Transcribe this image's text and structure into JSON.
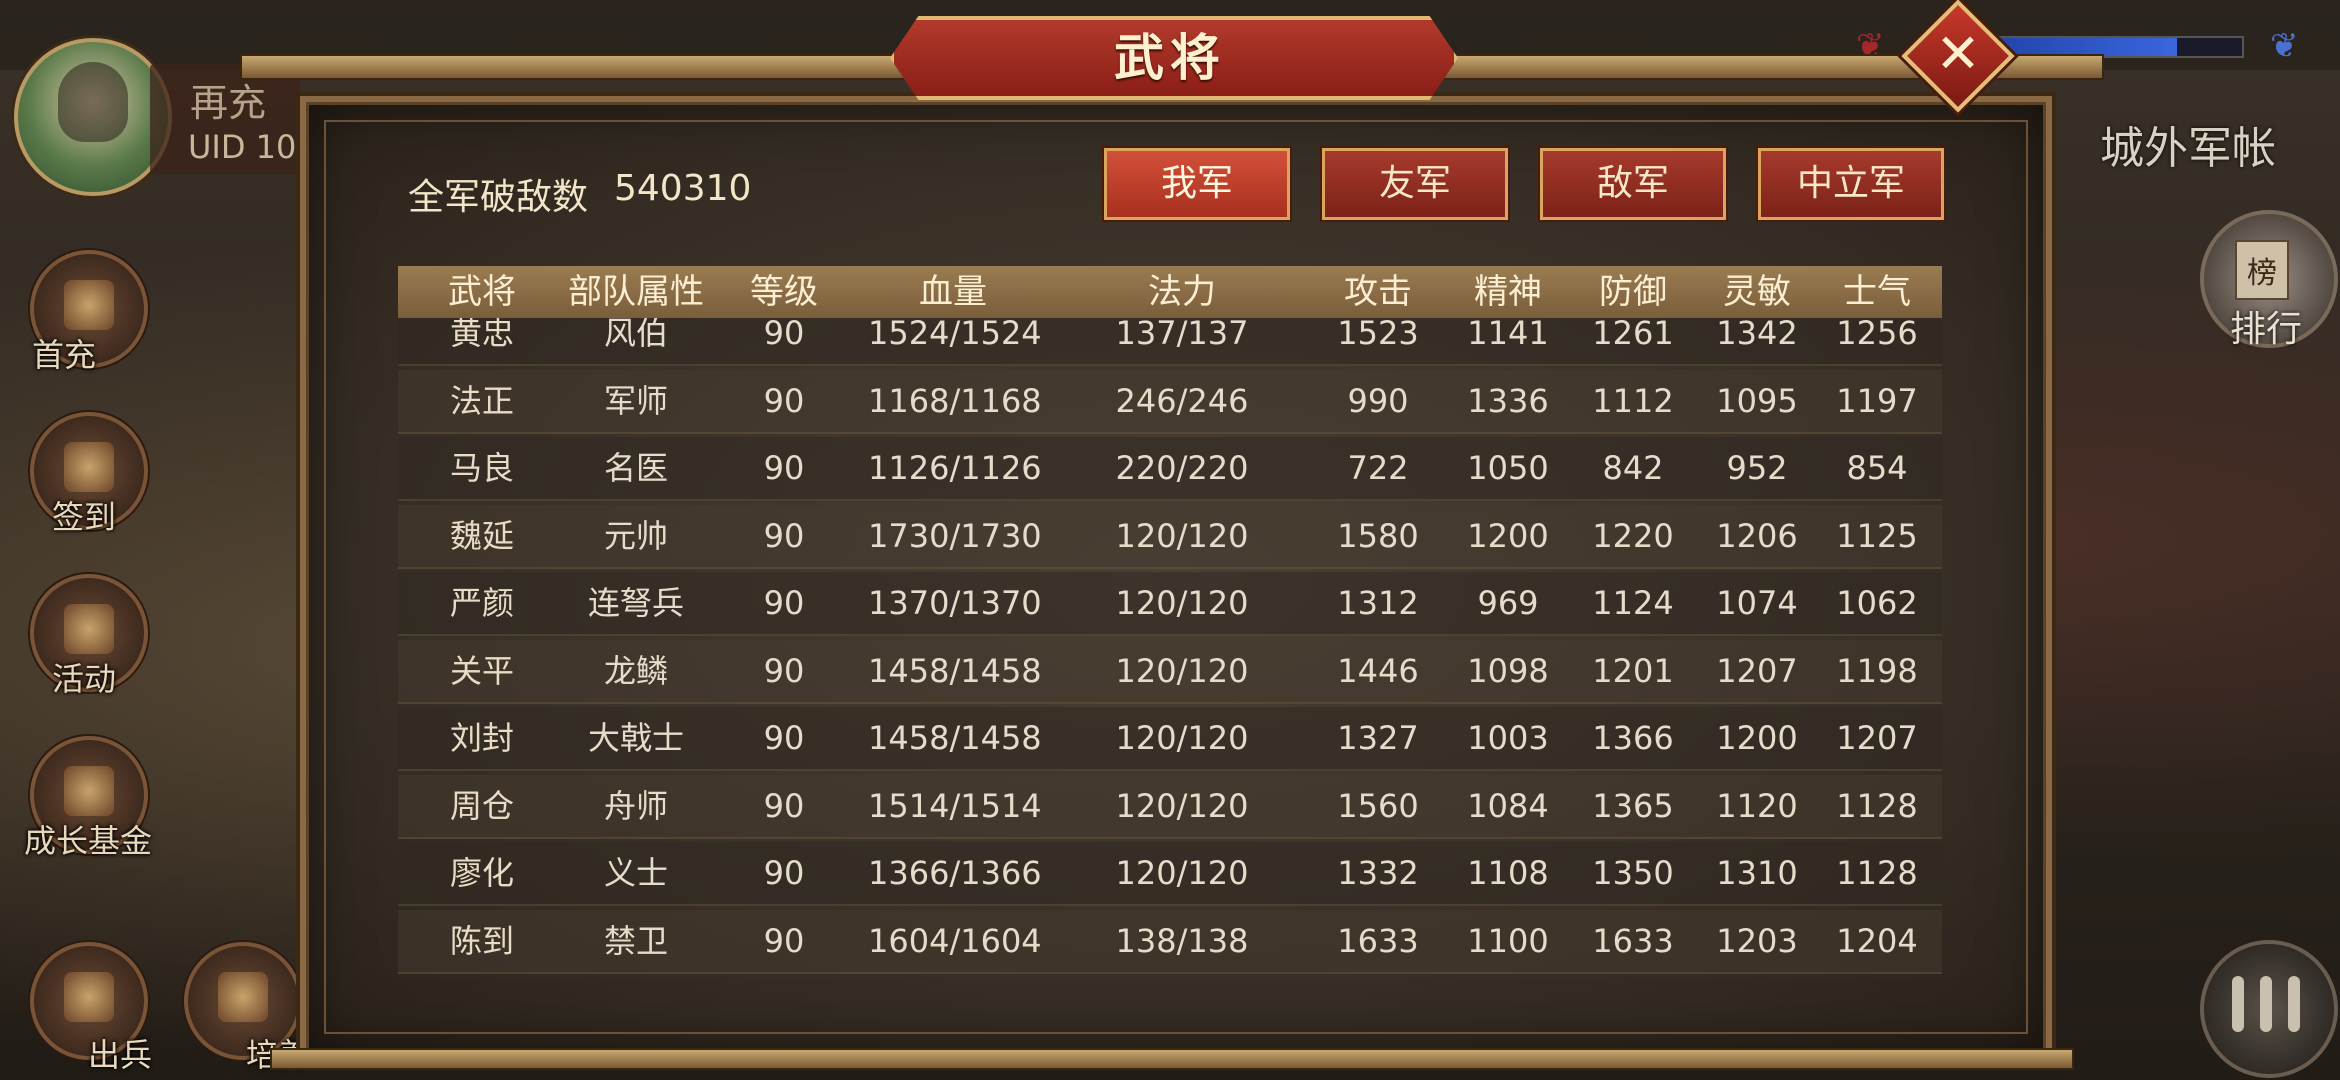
{
  "hud": {
    "player_name": "再充",
    "uid_label": "UID  10",
    "side_buttons": [
      {
        "label": "首充",
        "icon": "gift-icon"
      },
      {
        "label": "签到",
        "icon": "scroll-icon"
      },
      {
        "label": "活动",
        "icon": "treasure-icon"
      },
      {
        "label": "成长基金",
        "icon": "flower-icon"
      },
      {
        "label": "出兵",
        "icon": "sword-icon"
      },
      {
        "label": "培养",
        "icon": "drum-icon"
      }
    ],
    "right_label": "城外军帐",
    "rank_icon_text": "榜",
    "rank_label": "排行",
    "progress": 0.74
  },
  "dialog": {
    "title": "武将",
    "kill_label": "全军破敌数",
    "kill_value": "540310",
    "tabs": [
      "我军",
      "友军",
      "敌军",
      "中立军"
    ],
    "active_tab": 0,
    "columns": [
      "武将",
      "部队属性",
      "等级",
      "血量",
      "法力",
      "攻击",
      "精神",
      "防御",
      "灵敏",
      "士气"
    ],
    "rows": [
      [
        "黄忠",
        "风伯",
        "90",
        "1524/1524",
        "137/137",
        "1523",
        "1141",
        "1261",
        "1342",
        "1256"
      ],
      [
        "法正",
        "军师",
        "90",
        "1168/1168",
        "246/246",
        "990",
        "1336",
        "1112",
        "1095",
        "1197"
      ],
      [
        "马良",
        "名医",
        "90",
        "1126/1126",
        "220/220",
        "722",
        "1050",
        "842",
        "952",
        "854"
      ],
      [
        "魏延",
        "元帅",
        "90",
        "1730/1730",
        "120/120",
        "1580",
        "1200",
        "1220",
        "1206",
        "1125"
      ],
      [
        "严颜",
        "连弩兵",
        "90",
        "1370/1370",
        "120/120",
        "1312",
        "969",
        "1124",
        "1074",
        "1062"
      ],
      [
        "关平",
        "龙鳞",
        "90",
        "1458/1458",
        "120/120",
        "1446",
        "1098",
        "1201",
        "1207",
        "1198"
      ],
      [
        "刘封",
        "大戟士",
        "90",
        "1458/1458",
        "120/120",
        "1327",
        "1003",
        "1366",
        "1200",
        "1207"
      ],
      [
        "周仓",
        "舟师",
        "90",
        "1514/1514",
        "120/120",
        "1560",
        "1084",
        "1365",
        "1120",
        "1128"
      ],
      [
        "廖化",
        "义士",
        "90",
        "1366/1366",
        "120/120",
        "1332",
        "1108",
        "1350",
        "1310",
        "1128"
      ],
      [
        "陈到",
        "禁卫",
        "90",
        "1604/1604",
        "138/138",
        "1633",
        "1100",
        "1633",
        "1203",
        "1204"
      ]
    ]
  }
}
